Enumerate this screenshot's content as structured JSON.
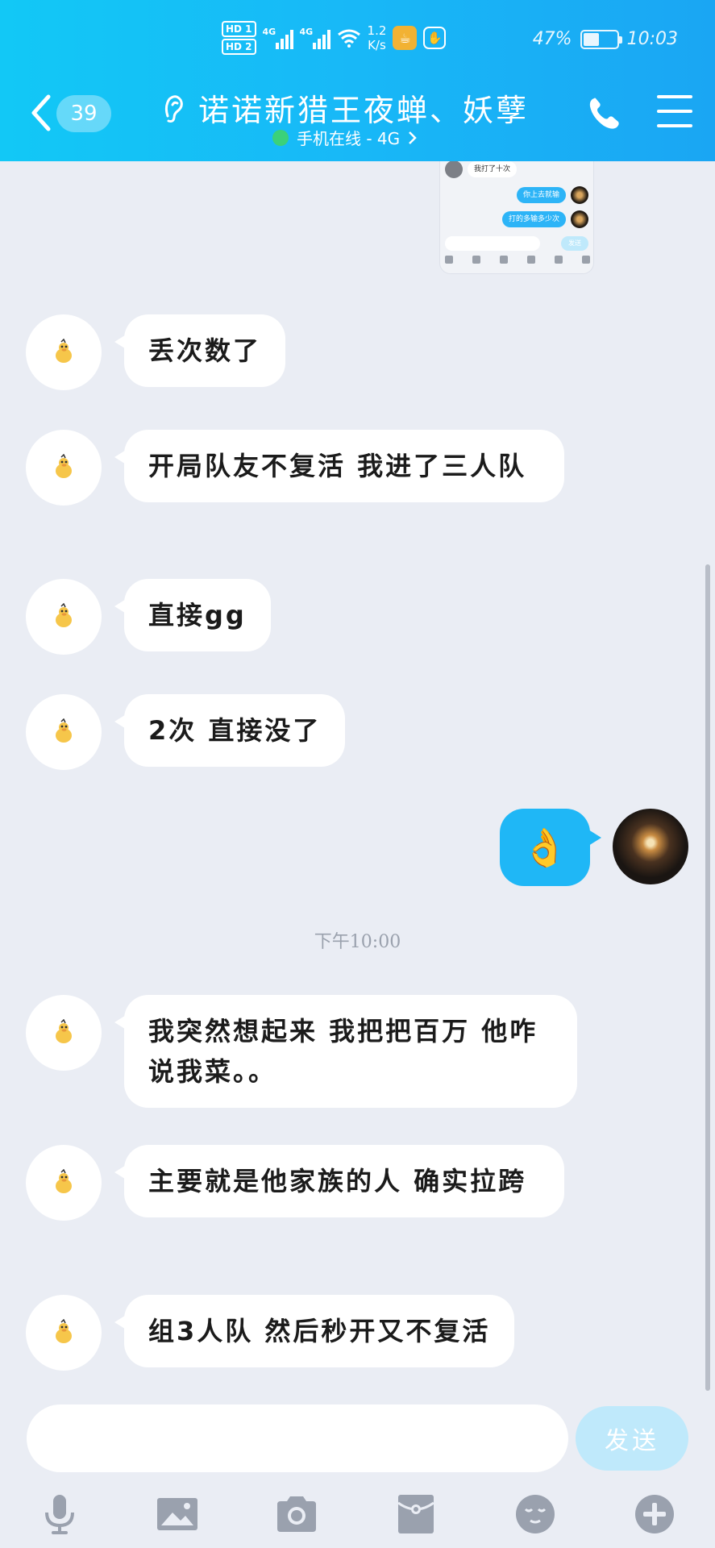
{
  "status_bar": {
    "hd1": "HD 1",
    "hd2": "HD 2",
    "sim1_net": "4G",
    "sim2_net": "4G",
    "speed_value": "1.2",
    "speed_unit": "K/s",
    "battery_percent": "47%",
    "battery_level": 0.47,
    "time": "10:03"
  },
  "header": {
    "unread_count": "39",
    "title": "诺诺新猎王夜蝉、妖孽",
    "subtitle": "手机在线 - 4G",
    "online_color": "#3bd17a"
  },
  "preview": {
    "line1": "我打了十次",
    "line2": "你上去就输",
    "line3": "打的多输多少次",
    "send": "发送"
  },
  "messages": [
    {
      "text": "丢次数了"
    },
    {
      "text": "开局队友不复活 我进了三人队"
    },
    {
      "text": "直接gg"
    },
    {
      "text": "2次 直接没了"
    },
    {
      "text": "我突然想起来 我把把百万 他咋说我菜。。"
    },
    {
      "text": "主要就是他家族的人 确实拉跨"
    },
    {
      "text": "组3人队 然后秒开又不复活"
    }
  ],
  "my_message": {
    "emoji": "👌"
  },
  "timestamp": "下午10:00",
  "input": {
    "value": "",
    "send_label": "发送"
  },
  "toolbar": {
    "icons": [
      "microphone-icon",
      "image-icon",
      "camera-icon",
      "red-packet-icon",
      "emoji-icon",
      "plus-icon"
    ]
  },
  "colors": {
    "header_start": "#12c8f6",
    "header_end": "#1aa6f3",
    "my_bubble": "#1fb7f6",
    "chat_bg": "#eaedf4",
    "send_disabled": "#bfe9fb"
  }
}
